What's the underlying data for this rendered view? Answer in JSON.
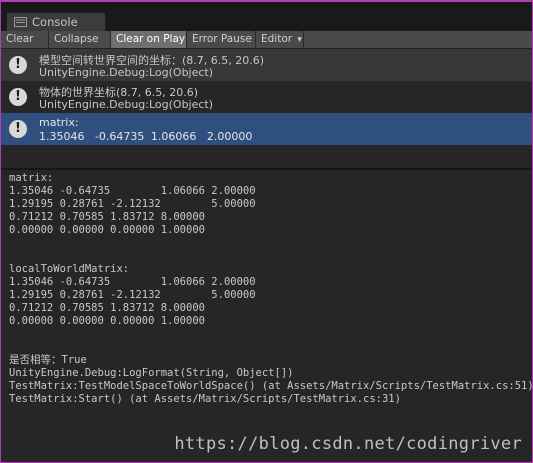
{
  "window": {
    "tab_label": "Console",
    "tab_icon": "console-list-icon"
  },
  "toolbar": {
    "clear": "Clear",
    "collapse": "Collapse",
    "clear_on_play": "Clear on Play",
    "error_pause": "Error Pause",
    "editor": "Editor",
    "editor_arrow": "▾",
    "active": "Clear on Play"
  },
  "entries": [
    {
      "icon": "info-exclamation-icon",
      "line1": "模型空间转世界空间的坐标：(8.7, 6.5, 20.6)",
      "line2": "UnityEngine.Debug:Log(Object)",
      "selected": false
    },
    {
      "icon": "info-exclamation-icon",
      "line1": "物体的世界坐标(8.7, 6.5, 20.6)",
      "line2": "UnityEngine.Debug:Log(Object)",
      "selected": false
    },
    {
      "icon": "info-exclamation-icon",
      "line1": "matrix:",
      "line2": "1.35046\t-0.64735\t1.06066\t2.00000",
      "selected": true
    }
  ],
  "detail_text": "matrix:\n1.35046\t-0.64735\t1.06066\t2.00000\n1.29195\t0.28761\t-2.12132\t5.00000\n0.71212\t0.70585\t1.83712\t8.00000\n0.00000\t0.00000\t0.00000\t1.00000\n\n\nlocalToWorldMatrix:\n1.35046\t-0.64735\t1.06066\t2.00000\n1.29195\t0.28761\t-2.12132\t5.00000\n0.71212\t0.70585\t1.83712\t8.00000\n0.00000\t0.00000\t0.00000\t1.00000\n\n\n是否相等：True\nUnityEngine.Debug:LogFormat(String, Object[])\nTestMatrix:TestModelSpaceToWorldSpace() (at Assets/Matrix/Scripts/TestMatrix.cs:51)\nTestMatrix:Start() (at Assets/Matrix/Scripts/TestMatrix.cs:31)",
  "watermark": "https://blog.csdn.net/codingriver",
  "colors": {
    "frame_border": "#b040b0",
    "selection": "#2f4f7f",
    "toolbar_active": "#6f6f6f"
  }
}
